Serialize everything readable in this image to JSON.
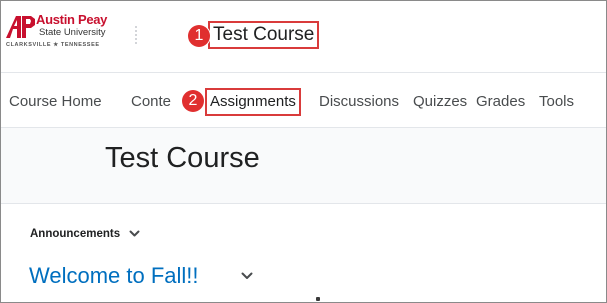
{
  "logo": {
    "line1": "Austin Peay",
    "line2": "State University",
    "line3": "CLARKSVILLE ★ TENNESSEE"
  },
  "header": {
    "course_title": "Test Course"
  },
  "callouts": {
    "one": "1",
    "two": "2"
  },
  "navbar": {
    "items": [
      {
        "label": "Course Home"
      },
      {
        "label": "Conte"
      },
      {
        "label": "Assignments"
      },
      {
        "label": "Discussions"
      },
      {
        "label": "Quizzes"
      },
      {
        "label": "Grades"
      },
      {
        "label": "Tools"
      }
    ]
  },
  "page": {
    "title": "Test Course"
  },
  "widget": {
    "header": "Announcements",
    "announcement_title": "Welcome to Fall!!"
  },
  "colors": {
    "highlight": "#d93b3b",
    "link": "#006fbf",
    "brand": "#c8102e"
  }
}
